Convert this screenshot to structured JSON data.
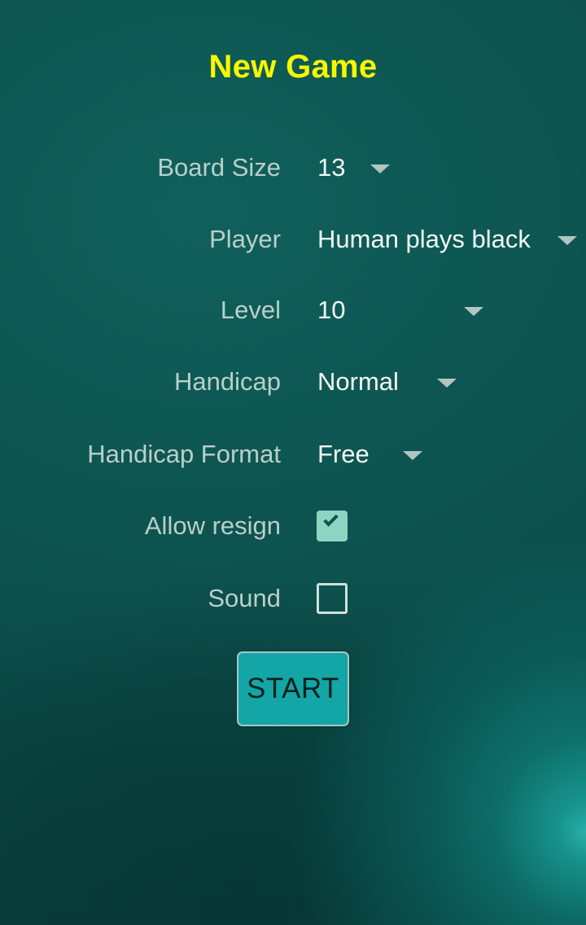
{
  "screen": {
    "title": "New Game",
    "title_color": "#f7f700",
    "background_color": "#0d5450",
    "label_color": "#b9cfca",
    "value_color": "#f3f8f6"
  },
  "settings": [
    {
      "label": "Board Size",
      "value": "13",
      "control": "dropdown"
    },
    {
      "label": "Player",
      "value": "Human plays black",
      "control": "dropdown"
    },
    {
      "label": "Level",
      "value": "10",
      "control": "dropdown"
    },
    {
      "label": "Handicap",
      "value": "Normal",
      "control": "dropdown"
    },
    {
      "label": "Handicap Format",
      "value": "Free",
      "control": "dropdown"
    },
    {
      "label": "Allow resign",
      "value": "checked",
      "control": "checkbox"
    },
    {
      "label": "Sound",
      "value": "unchecked",
      "control": "checkbox"
    }
  ],
  "actions": {
    "start_label": "START",
    "start_fill": "#14a6a6",
    "start_border": "#a9c6c1",
    "start_text_color": "#08201f"
  },
  "checkbox": {
    "checked_fill": "#8ed4c2",
    "unchecked_border": "#cfe0dc"
  },
  "icons": {
    "dropdown_arrow": "chevron-down-icon",
    "check": "check-icon"
  }
}
